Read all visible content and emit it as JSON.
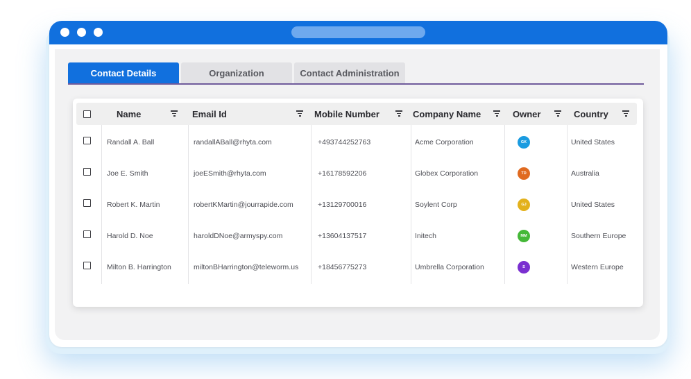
{
  "window": {
    "titlebar_color": "#1170de"
  },
  "tabs": [
    {
      "label": "Contact Details",
      "active": true
    },
    {
      "label": "Organization",
      "active": false
    },
    {
      "label": "Contact Administration",
      "active": false
    }
  ],
  "table": {
    "columns": [
      {
        "key": "name",
        "label": "Name"
      },
      {
        "key": "email",
        "label": "Email Id"
      },
      {
        "key": "mobile",
        "label": "Mobile Number"
      },
      {
        "key": "company",
        "label": "Company Name"
      },
      {
        "key": "owner",
        "label": "Owner"
      },
      {
        "key": "country",
        "label": "Country"
      }
    ],
    "rows": [
      {
        "name": "Randall A. Ball",
        "email": "randallABall@rhyta.com",
        "mobile": "+493744252763",
        "company": "Acme Corporation",
        "owner_initials": "GK",
        "owner_color": "#1a9be0",
        "country": "United States"
      },
      {
        "name": "Joe E. Smith",
        "email": "joeESmith@rhyta.com",
        "mobile": "+16178592206",
        "company": "Globex Corporation",
        "owner_initials": "TD",
        "owner_color": "#e06a20",
        "country": "Australia"
      },
      {
        "name": "Robert K. Martin",
        "email": "robertKMartin@jourrapide.com",
        "mobile": "+13129700016",
        "company": "Soylent Corp",
        "owner_initials": "GJ",
        "owner_color": "#e3b11c",
        "country": "United States"
      },
      {
        "name": "Harold D. Noe",
        "email": "haroldDNoe@armyspy.com",
        "mobile": "+13604137517",
        "company": "Initech",
        "owner_initials": "MM",
        "owner_color": "#45b838",
        "country": "Southern Europe"
      },
      {
        "name": "Milton B. Harrington",
        "email": "miltonBHarrington@teleworm.us",
        "mobile": "+18456775273",
        "company": "Umbrella Corporation",
        "owner_initials": "S",
        "owner_color": "#7a2fd0",
        "country": "Western Europe"
      }
    ]
  }
}
